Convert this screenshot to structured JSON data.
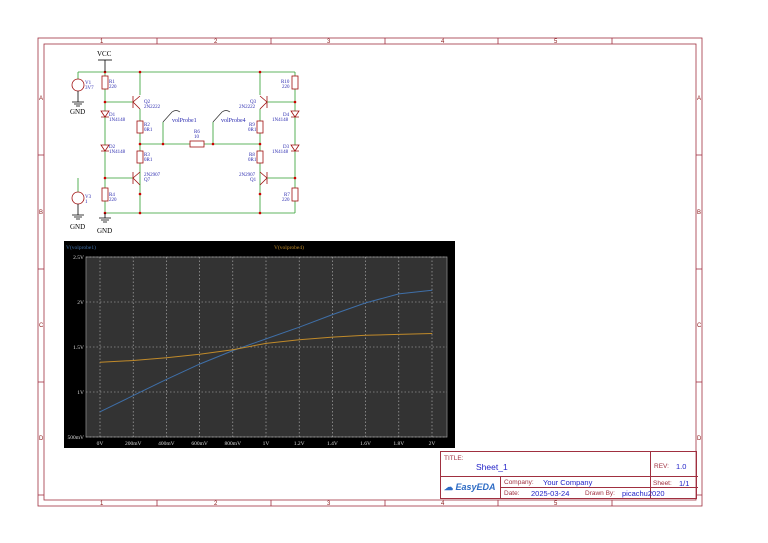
{
  "frame": {
    "columns": [
      "1",
      "2",
      "3",
      "4",
      "5"
    ],
    "rows": [
      "A",
      "B",
      "C",
      "D"
    ]
  },
  "schematic": {
    "vcc": "VCC",
    "gnd": "GND",
    "probes": [
      "volProbe1",
      "volProbe4"
    ],
    "components": {
      "V1": [
        "V1",
        "3V7"
      ],
      "V3": [
        "V3",
        "1"
      ],
      "R1": [
        "R1",
        "220"
      ],
      "R4": [
        "R4",
        "220"
      ],
      "R10": [
        "R10",
        "220"
      ],
      "R7": [
        "R7",
        "220"
      ],
      "R2": [
        "R2",
        "0R1"
      ],
      "R3": [
        "R3",
        "0R1"
      ],
      "R9": [
        "R9",
        "0R1"
      ],
      "R8": [
        "R8",
        "0R1"
      ],
      "R6": [
        "R6",
        "10"
      ],
      "D1": [
        "D1",
        "1N4148"
      ],
      "D2": [
        "D2",
        "1N4148"
      ],
      "D4": [
        "D4",
        "1N4148"
      ],
      "D3": [
        "D3",
        "1N4148"
      ],
      "Q2": [
        "Q2",
        "2N2222"
      ],
      "Q3": [
        "Q3",
        "2N2222"
      ],
      "Q7": [
        "2N2907",
        "Q7"
      ],
      "Q1": [
        "2N2907",
        "Q1"
      ]
    }
  },
  "colors": {
    "series1": "#3f6fa8",
    "series2": "#c08a2a",
    "frame": "#8b1a1a",
    "wire": "#2e9e2e"
  },
  "chart_data": {
    "type": "line",
    "legend": [
      "V(volprobe1)",
      "V(volprobe4)"
    ],
    "x": [
      0,
      0.2,
      0.4,
      0.6,
      0.8,
      1.0,
      1.2,
      1.4,
      1.6,
      1.8,
      2.0
    ],
    "xtick_labels": [
      "0V",
      "200mV",
      "400mV",
      "600mV",
      "800mV",
      "1V",
      "1.2V",
      "1.4V",
      "1.6V",
      "1.8V",
      "2V"
    ],
    "yticks": [
      0.5,
      1,
      1.5,
      2,
      2.5
    ],
    "ytick_labels": [
      "500mV",
      "1V",
      "1.5V",
      "2V",
      "2.5V"
    ],
    "xlim": [
      0,
      2
    ],
    "ylim": [
      0.5,
      2.5
    ],
    "grid": true,
    "series": [
      {
        "name": "V(volprobe1)",
        "values": [
          0.78,
          0.96,
          1.14,
          1.31,
          1.46,
          1.59,
          1.72,
          1.86,
          1.99,
          2.09,
          2.13
        ]
      },
      {
        "name": "V(volprobe4)",
        "values": [
          1.33,
          1.35,
          1.38,
          1.42,
          1.47,
          1.54,
          1.58,
          1.61,
          1.63,
          1.64,
          1.65
        ]
      }
    ]
  },
  "title_block": {
    "title_label": "TITLE:",
    "title": "Sheet_1",
    "rev_label": "REV:",
    "rev": "1.0",
    "company_label": "Company:",
    "company": "Your Company",
    "sheet_label": "Sheet:",
    "sheet": "1/1",
    "date_label": "Date:",
    "date": "2025-03-24",
    "drawn_label": "Drawn By:",
    "drawn_by": "picachu2020",
    "logo": "EasyEDA"
  }
}
